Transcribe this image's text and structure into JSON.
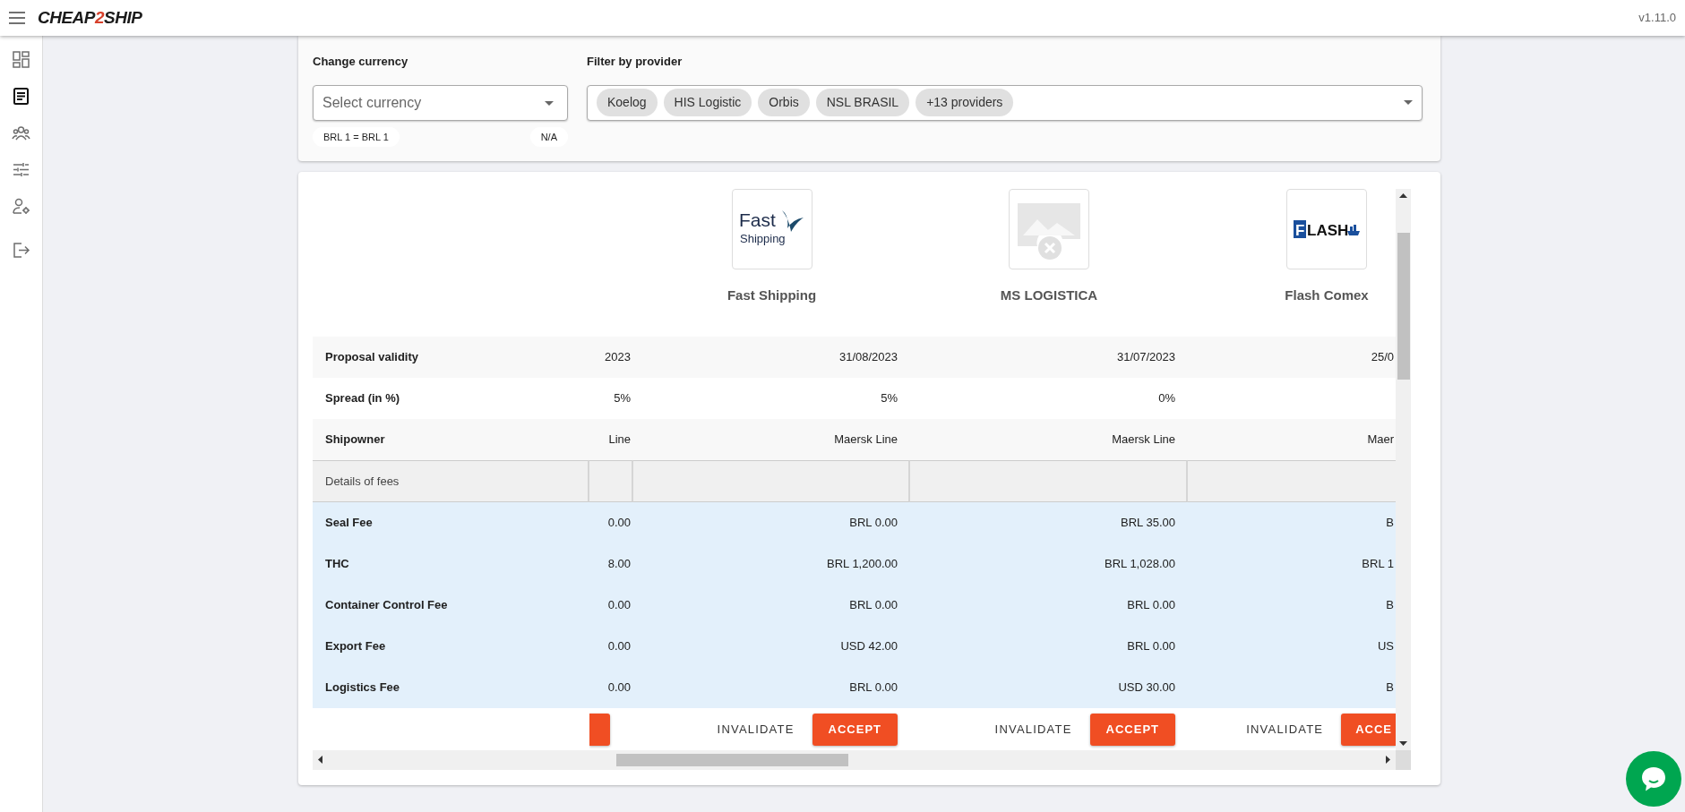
{
  "top_bar": {
    "logo": {
      "before": "CHEAP",
      "accent": "2",
      "after": "SHIP"
    },
    "version": "v1.11.0"
  },
  "sidebar": {
    "items": [
      {
        "kind": "dashboard",
        "selected": false
      },
      {
        "kind": "document",
        "selected": true
      },
      {
        "kind": "group",
        "selected": false
      },
      {
        "kind": "sliders",
        "selected": false
      },
      {
        "kind": "user-gear",
        "selected": false
      },
      {
        "kind": "logout",
        "selected": false
      }
    ]
  },
  "filters": {
    "currency": {
      "label": "Change currency",
      "placeholder": "Select currency",
      "rate": "BRL 1 = BRL 1",
      "rate_status": "N/A"
    },
    "provider": {
      "label": "Filter by provider",
      "chips": [
        "Koelog",
        "HIS Logistic",
        "Orbis",
        "NSL BRASIL",
        "+13 providers"
      ]
    }
  },
  "comparison": {
    "providers": [
      {
        "accept_fragment": true
      },
      {
        "name": "Fast Shipping",
        "logo": {
          "kind": "fast",
          "lines": [
            "Fast",
            "Shipping"
          ]
        },
        "invalidate": "INVALIDATE",
        "accept": "ACCEPT"
      },
      {
        "name": "MS LOGISTICA",
        "logo": {
          "kind": "broken"
        },
        "invalidate": "INVALIDATE",
        "accept": "ACCEPT"
      },
      {
        "name": "Flash Comex",
        "logo": {
          "kind": "flash",
          "lines": [
            "F",
            "LASH"
          ]
        },
        "invalidate": "INVALIDATE",
        "accept": "ACCE"
      }
    ],
    "rows": [
      {
        "kind": "info",
        "label": "Proposal validity",
        "values": [
          "2023",
          "31/08/2023",
          "31/07/2023",
          "25/0"
        ]
      },
      {
        "kind": "info",
        "label": "Spread (in %)",
        "values": [
          "5%",
          "5%",
          "0%"
        ]
      },
      {
        "kind": "info",
        "label": "Shipowner",
        "values": [
          "Line",
          "Maersk Line",
          "Maersk Line",
          "Maer"
        ]
      },
      {
        "kind": "section",
        "label": "Details of fees"
      },
      {
        "kind": "fee",
        "label": "Seal Fee",
        "values": [
          "0.00",
          "BRL 0.00",
          "BRL 35.00",
          "B"
        ]
      },
      {
        "kind": "fee",
        "label": "THC",
        "values": [
          "8.00",
          "BRL 1,200.00",
          "BRL 1,028.00",
          "BRL 1"
        ]
      },
      {
        "kind": "fee",
        "label": "Container Control Fee",
        "values": [
          "0.00",
          "BRL 0.00",
          "BRL 0.00",
          "B"
        ]
      },
      {
        "kind": "fee",
        "label": "Export Fee",
        "values": [
          "0.00",
          "USD 42.00",
          "BRL 0.00",
          "US"
        ]
      },
      {
        "kind": "fee",
        "label": "Logistics Fee",
        "values": [
          "0.00",
          "BRL 0.00",
          "USD 30.00",
          "B"
        ]
      }
    ]
  }
}
